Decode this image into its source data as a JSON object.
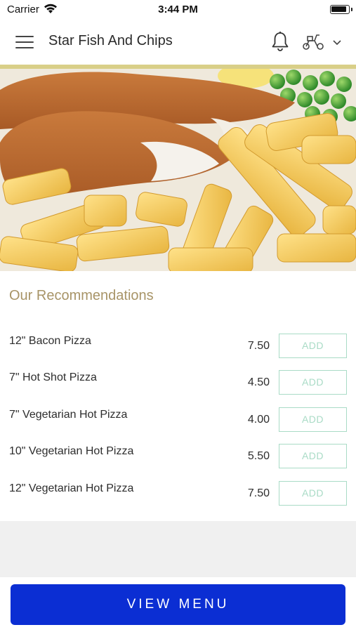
{
  "status_bar": {
    "carrier": "Carrier",
    "time": "3:44 PM"
  },
  "header": {
    "store_name": "Star Fish And Chips",
    "icons": [
      "menu-icon",
      "bell-icon",
      "scooter-icon",
      "chevron-down-icon"
    ]
  },
  "accent_color": "#d9cf88",
  "hero": {
    "description_icon": "fish-and-chips-photo"
  },
  "recommendations": {
    "title": "Our Recommendations",
    "items": [
      {
        "name": "12\" Bacon Pizza",
        "price": "7.50",
        "button": "ADD"
      },
      {
        "name": "7\" Hot Shot Pizza",
        "price": "4.50",
        "button": "ADD"
      },
      {
        "name": "7\" Vegetarian Hot Pizza",
        "price": "4.00",
        "button": "ADD"
      },
      {
        "name": "10\" Vegetarian Hot Pizza",
        "price": "5.50",
        "button": "ADD"
      },
      {
        "name": "12\" Vegetarian Hot Pizza",
        "price": "7.50",
        "button": "ADD"
      }
    ]
  },
  "colors": {
    "title": "#a89467",
    "add_button": "#a9dbc6",
    "primary_button": "#0b2ed3"
  },
  "footer": {
    "view_menu_label": "VIEW MENU"
  }
}
